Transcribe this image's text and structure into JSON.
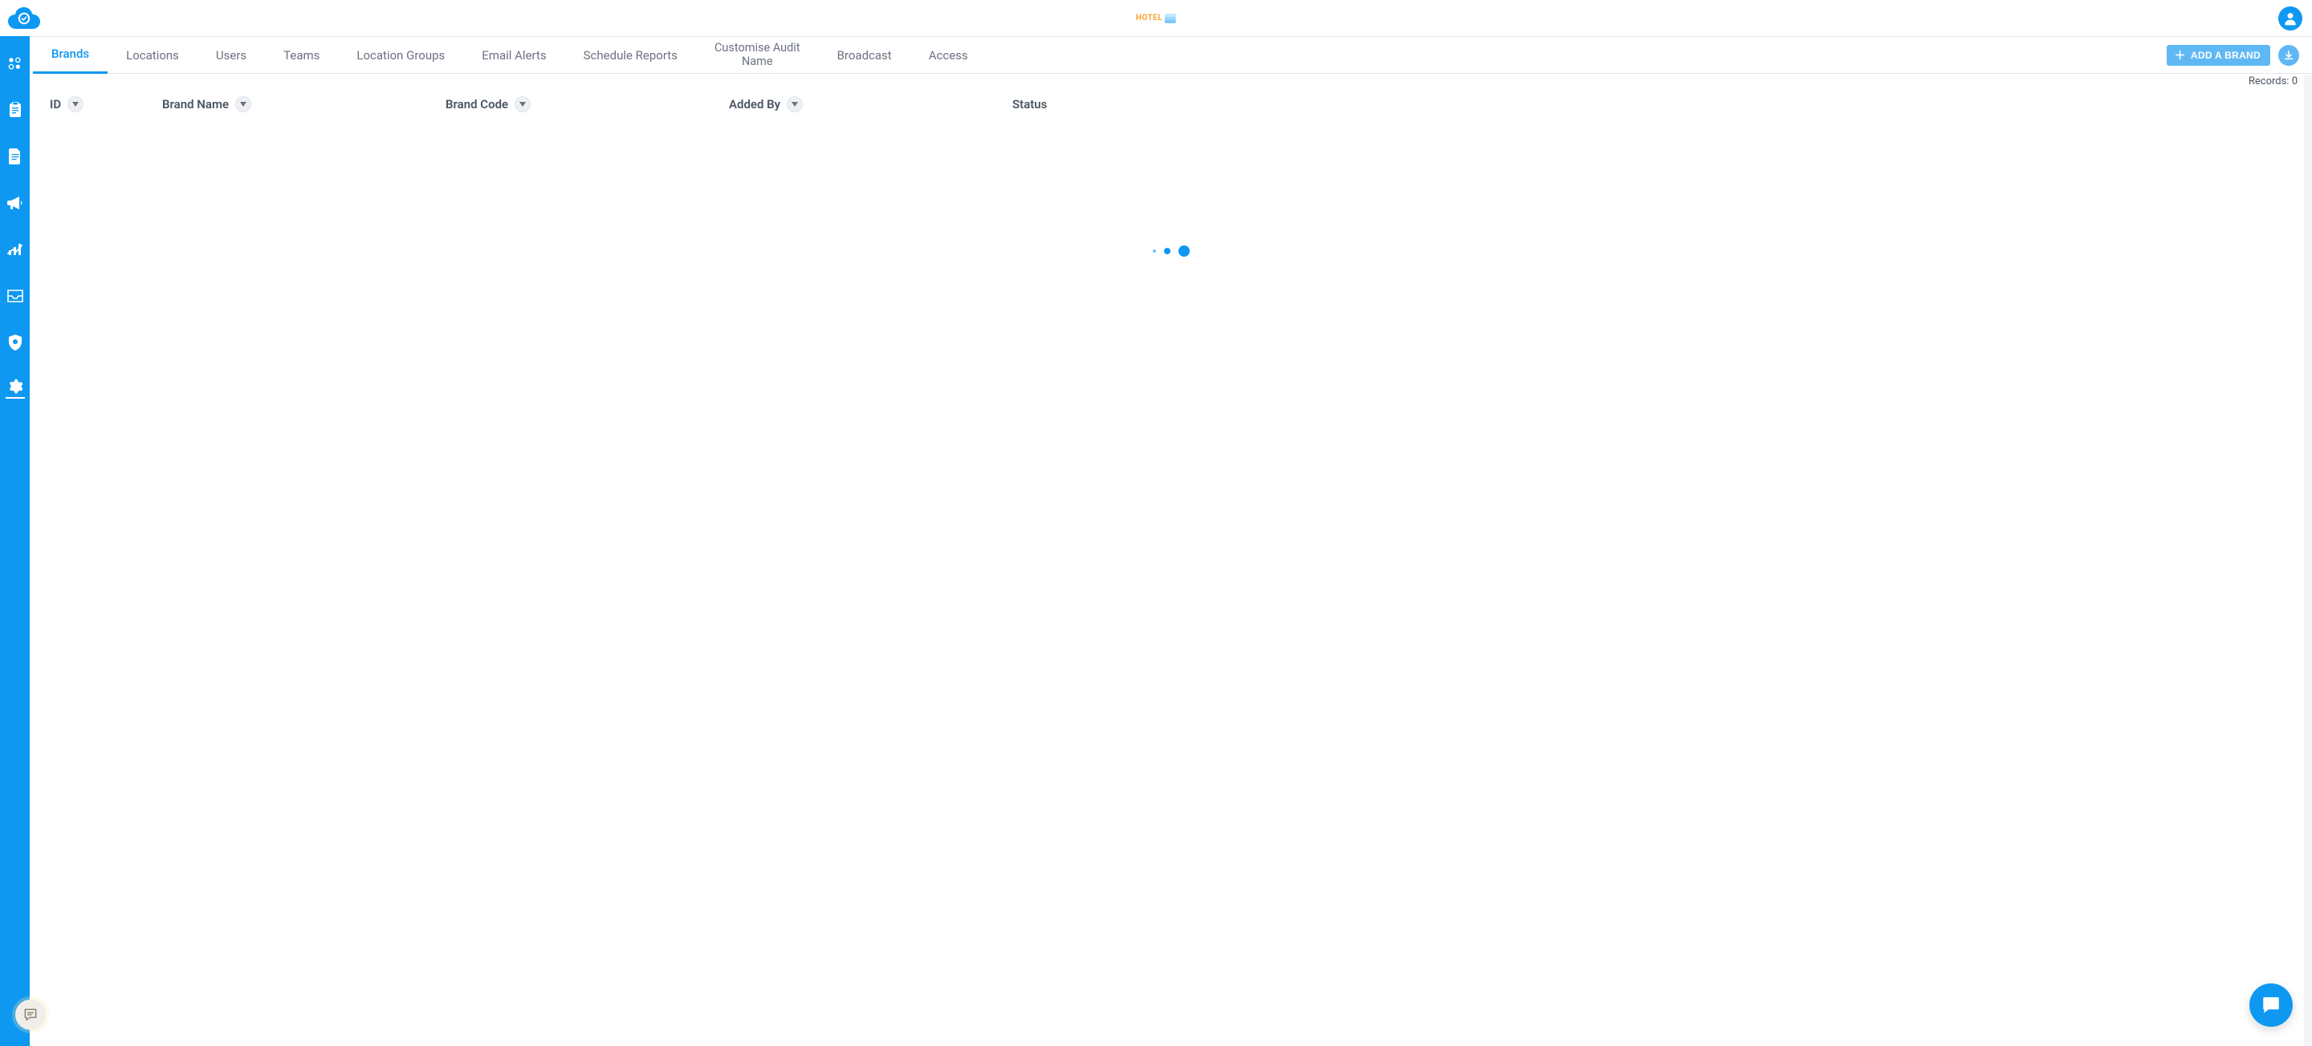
{
  "header": {
    "brand_logo_name": "cloud-check-logo",
    "center_logo_text": "HOTEL"
  },
  "tabs": [
    {
      "label": "Brands",
      "active": true
    },
    {
      "label": "Locations",
      "active": false
    },
    {
      "label": "Users",
      "active": false
    },
    {
      "label": "Teams",
      "active": false
    },
    {
      "label": "Location Groups",
      "active": false
    },
    {
      "label": "Email Alerts",
      "active": false
    },
    {
      "label": "Schedule Reports",
      "active": false
    },
    {
      "label": "Customise Audit\nName",
      "active": false
    },
    {
      "label": "Broadcast",
      "active": false
    },
    {
      "label": "Access",
      "active": false
    }
  ],
  "actions": {
    "add_button_label": "ADD A BRAND"
  },
  "records": {
    "label_prefix": "Records: ",
    "count": 0
  },
  "columns": {
    "id": "ID",
    "brand_name": "Brand Name",
    "brand_code": "Brand Code",
    "added_by": "Added By",
    "status": "Status"
  },
  "sidebar_icons": [
    "dashboard-icon",
    "clipboard-icon",
    "document-icon",
    "megaphone-icon",
    "chart-icon",
    "inbox-icon",
    "shield-icon",
    "settings-icon"
  ]
}
